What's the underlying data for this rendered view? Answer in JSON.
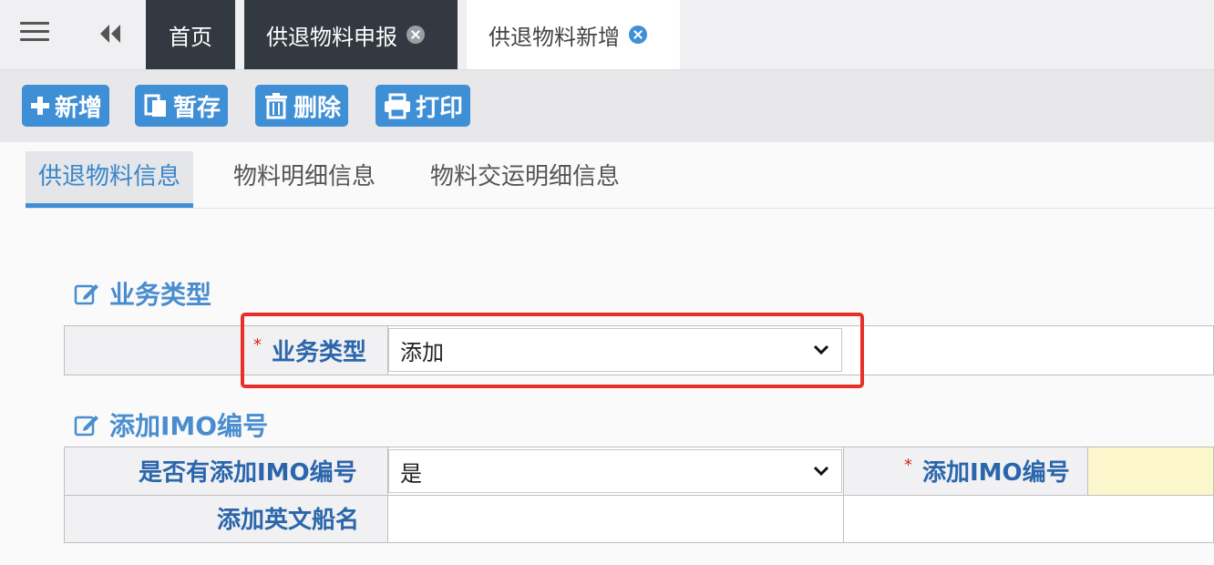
{
  "top_tabs": {
    "home": "首页",
    "tab1": "供退物料申报",
    "tab2": "供退物料新增"
  },
  "toolbar": {
    "add": "新增",
    "save": "暂存",
    "delete": "删除",
    "print": "打印"
  },
  "sub_tabs": {
    "tab1": "供退物料信息",
    "tab2": "物料明细信息",
    "tab3": "物料交运明细信息"
  },
  "section_business": {
    "title": "业务类型",
    "field_label": "业务类型",
    "required_mark": "*",
    "value": "添加"
  },
  "section_imo": {
    "title": "添加IMO编号",
    "has_imo_label": "是否有添加IMO编号",
    "has_imo_value": "是",
    "imo_label": "添加IMO编号",
    "imo_required_mark": "*",
    "ship_name_label": "添加英文船名"
  },
  "colors": {
    "accent": "#3f8fd6",
    "dark_tab": "#323940",
    "label_blue": "#2b66ab",
    "required_red": "#d9241c",
    "highlight_red": "#e8302a",
    "required_field_bg": "#fbf6cc"
  }
}
